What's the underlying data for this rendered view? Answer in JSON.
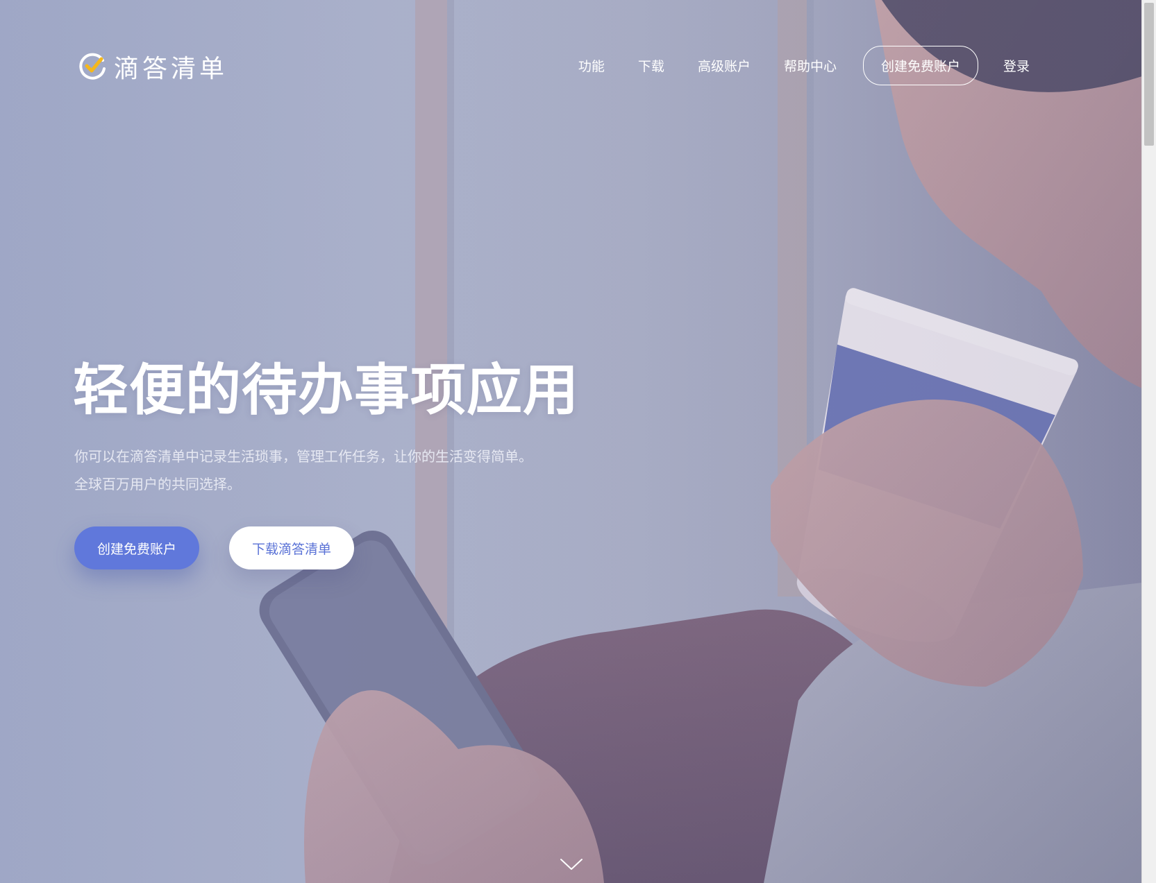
{
  "brand": {
    "name": "滴答清单",
    "logo_icon": "checkmark-circle-icon"
  },
  "nav": {
    "items": [
      {
        "label": "功能"
      },
      {
        "label": "下载"
      },
      {
        "label": "高级账户"
      },
      {
        "label": "帮助中心"
      }
    ],
    "cta_label": "创建免费账户",
    "login_label": "登录"
  },
  "hero": {
    "title": "轻便的待办事项应用",
    "subtitle_line1": "你可以在滴答清单中记录生活琐事，管理工作任务，让你的生活变得简单。",
    "subtitle_line2": "全球百万用户的共同选择。",
    "primary_button": "创建免费账户",
    "secondary_button": "下载滴答清单",
    "scroll_icon": "chevron-down-icon"
  },
  "colors": {
    "accent": "#6078db",
    "logo_check": "#f5b81c",
    "text_on_bg": "#ffffff"
  }
}
